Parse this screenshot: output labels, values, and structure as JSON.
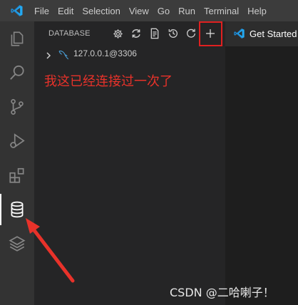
{
  "menubar": {
    "logo_icon": "vscode-logo-icon",
    "items": [
      "File",
      "Edit",
      "Selection",
      "View",
      "Go",
      "Run",
      "Terminal",
      "Help"
    ]
  },
  "activitybar": {
    "items": [
      {
        "name": "explorer-icon",
        "active": false
      },
      {
        "name": "search-icon",
        "active": false
      },
      {
        "name": "source-control-icon",
        "active": false
      },
      {
        "name": "run-debug-icon",
        "active": false
      },
      {
        "name": "extensions-icon",
        "active": false
      },
      {
        "name": "database-icon",
        "active": true
      },
      {
        "name": "layers-icon",
        "active": false
      }
    ]
  },
  "sidebar": {
    "title": "DATABASE",
    "toolbar": [
      {
        "name": "settings-gear-icon"
      },
      {
        "name": "refresh-sync-icon"
      },
      {
        "name": "sql-file-icon"
      },
      {
        "name": "history-icon"
      },
      {
        "name": "reload-icon"
      },
      {
        "name": "add-connection-icon"
      }
    ],
    "connection": {
      "label": "127.0.0.1@3306",
      "icon": "mysql-dolphin-icon",
      "expand_icon": "chevron-right-icon"
    },
    "annotation": "我这已经连接过一次了"
  },
  "editor": {
    "tab_label": "Get Started",
    "tab_icon": "vscode-logo-icon"
  },
  "watermark": "CSDN @二哈喇子！",
  "colors": {
    "annotation_red": "#e8322a",
    "menubar_bg": "#3c3c3c",
    "activitybar_bg": "#333333",
    "sidebar_bg": "#252526",
    "vscode_blue": "#23a9f2"
  }
}
